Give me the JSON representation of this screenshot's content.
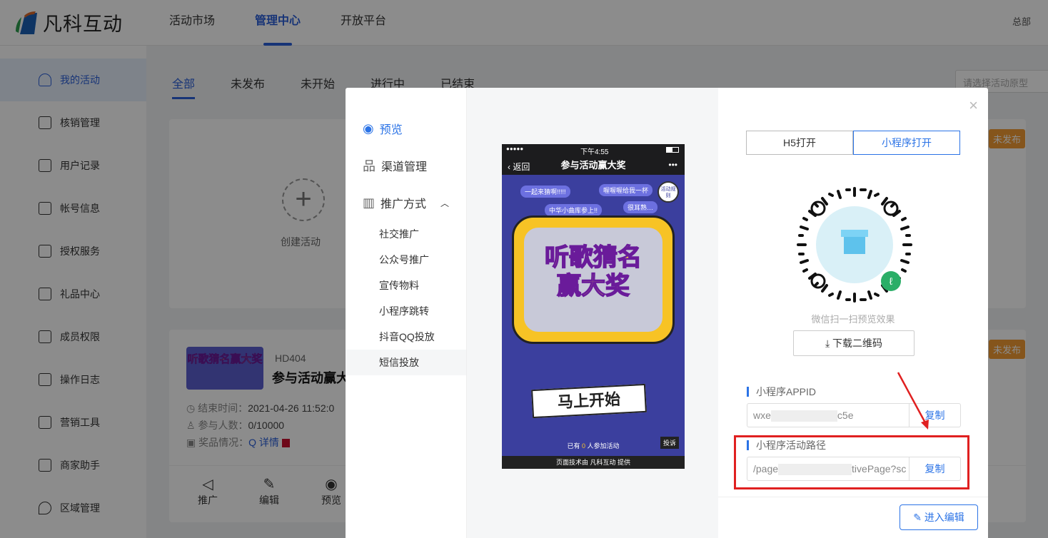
{
  "header": {
    "brand": "凡科互动",
    "nav": [
      {
        "label": "活动市场"
      },
      {
        "label": "管理中心"
      },
      {
        "label": "开放平台"
      }
    ],
    "right": "总部"
  },
  "sidebar": {
    "items": [
      {
        "label": "我的活动"
      },
      {
        "label": "核销管理"
      },
      {
        "label": "用户记录"
      },
      {
        "label": "帐号信息"
      },
      {
        "label": "授权服务"
      },
      {
        "label": "礼品中心"
      },
      {
        "label": "成员权限"
      },
      {
        "label": "操作日志"
      },
      {
        "label": "营销工具"
      },
      {
        "label": "商家助手"
      },
      {
        "label": "区域管理"
      }
    ]
  },
  "main": {
    "tabs": [
      {
        "label": "全部"
      },
      {
        "label": "未发布"
      },
      {
        "label": "未开始"
      },
      {
        "label": "进行中"
      },
      {
        "label": "已结束"
      }
    ],
    "select_placeholder": "请选择活动原型",
    "create_label": "创建活动",
    "badge": "未发布",
    "activity": {
      "id": "HD404",
      "title": "参与活动赢大奖",
      "thumb_text": "听歌猜名赢大奖",
      "end_label": "结束时间：",
      "end_value": "2021-04-26 11:52:0",
      "count_label": "参与人数：",
      "count_value": "0/10000",
      "prize_label": "奖品情况：",
      "prize_link": "详情",
      "actions": [
        {
          "label": "推广"
        },
        {
          "label": "编辑"
        },
        {
          "label": "预览"
        }
      ]
    }
  },
  "modal": {
    "menu": {
      "preview": "预览",
      "channel": "渠道管理",
      "promo": "推广方式",
      "subs": [
        {
          "label": "社交推广"
        },
        {
          "label": "公众号推广"
        },
        {
          "label": "宣传物料"
        },
        {
          "label": "小程序跳转"
        },
        {
          "label": "抖音QQ投放"
        },
        {
          "label": "短信投放"
        }
      ]
    },
    "phone": {
      "time": "下午4:55",
      "back": "返回",
      "title": "参与活动赢大奖",
      "poster_line1": "听歌猜名",
      "poster_line2": "赢大奖",
      "start": "马上开始",
      "bubbles": [
        "一起来猜啊!!!!!",
        "喔喔喔给我一杯",
        "中华小曲库参上!!",
        "很耳熟…"
      ],
      "joined_pre": "已有",
      "joined_count": "0",
      "joined_post": "人参加活动",
      "report": "投诉",
      "footer": "页面技术由 凡科互动 提供",
      "badge": "活动规则"
    },
    "toggle": [
      {
        "label": "H5打开"
      },
      {
        "label": "小程序打开"
      }
    ],
    "qr_caption": "微信扫一扫预览效果",
    "download": "下载二维码",
    "appid_label": "小程序APPID",
    "appid_pre": "wxe",
    "appid_post": "c5e",
    "path_label": "小程序活动路径",
    "path_pre": "/page",
    "path_post": "tivePage?sc",
    "copy": "复制",
    "edit": "进入编辑",
    "colors": {
      "accent": "#2b73e6",
      "highlight": "#e02020"
    }
  }
}
